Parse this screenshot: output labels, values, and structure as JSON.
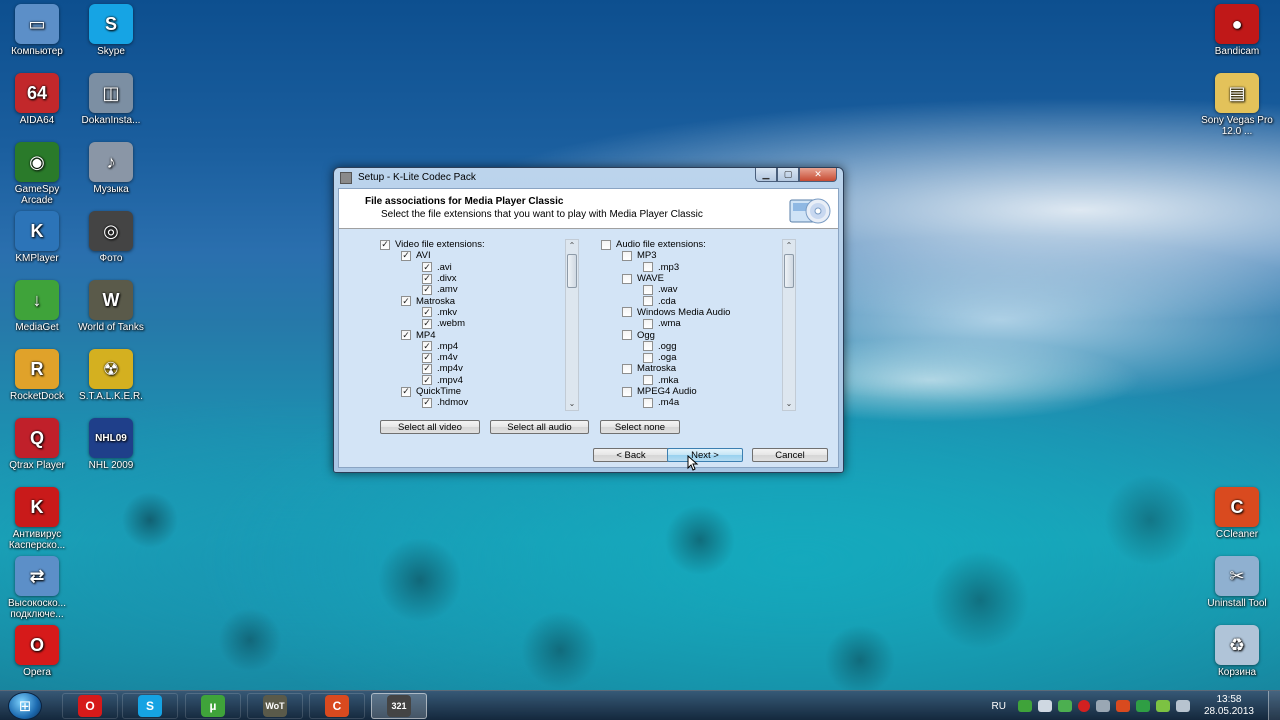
{
  "desktop": {
    "left_icons": [
      {
        "label": "Компьютер",
        "icon": "computer-icon"
      },
      {
        "label": "Skype",
        "icon": "skype-icon"
      },
      {
        "label": "AIDA64",
        "icon": "aida64-icon"
      },
      {
        "label": "DokanInsta...",
        "icon": "installer-icon"
      },
      {
        "label": "GameSpy Arcade",
        "icon": "gamespy-icon"
      },
      {
        "label": "Музыка",
        "icon": "music-folder-icon"
      },
      {
        "label": "KMPlayer",
        "icon": "kmplayer-icon"
      },
      {
        "label": "Фото",
        "icon": "camera-icon"
      },
      {
        "label": "MediaGet",
        "icon": "mediaget-icon"
      },
      {
        "label": "World of Tanks",
        "icon": "world-of-tanks-icon"
      },
      {
        "label": "RocketDock",
        "icon": "rocketdock-icon"
      },
      {
        "label": "S.T.A.L.K.E.R.",
        "icon": "stalker-icon"
      },
      {
        "label": "Qtrax Player",
        "icon": "qtrax-icon"
      },
      {
        "label": "NHL 2009",
        "icon": "nhl-icon"
      },
      {
        "label": "Антивирус Касперско...",
        "icon": "kaspersky-icon"
      },
      {
        "label": "Высокоско... подключе...",
        "icon": "network-connection-icon"
      },
      {
        "label": "Opera",
        "icon": "opera-icon"
      }
    ],
    "right_icons": [
      {
        "label": "Bandicam",
        "icon": "bandicam-icon"
      },
      {
        "label": "Sony Vegas Pro 12.0 ...",
        "icon": "folder-icon"
      },
      {
        "label": "CCleaner",
        "icon": "ccleaner-icon"
      },
      {
        "label": "Uninstall Tool",
        "icon": "uninstall-tool-icon"
      },
      {
        "label": "Корзина",
        "icon": "recycle-bin-icon"
      }
    ],
    "icon_badges": {
      "aida": "64",
      "bandicam": "●",
      "nhl": "NHL09"
    }
  },
  "window": {
    "title": "Setup - K-Lite Codec Pack",
    "minimize_glyph": "▁",
    "maximize_glyph": "▢",
    "close_glyph": "✕",
    "header_title": "File associations for Media Player Classic",
    "header_subtitle": "Select the file extensions that you want to play with Media Player Classic",
    "video_list": [
      {
        "label": "Video file extensions:",
        "level": 0,
        "checked": true
      },
      {
        "label": "AVI",
        "level": 1,
        "checked": true
      },
      {
        "label": ".avi",
        "level": 2,
        "checked": true
      },
      {
        "label": ".divx",
        "level": 2,
        "checked": true
      },
      {
        "label": ".amv",
        "level": 2,
        "checked": true
      },
      {
        "label": "Matroska",
        "level": 1,
        "checked": true
      },
      {
        "label": ".mkv",
        "level": 2,
        "checked": true
      },
      {
        "label": ".webm",
        "level": 2,
        "checked": true
      },
      {
        "label": "MP4",
        "level": 1,
        "checked": true
      },
      {
        "label": ".mp4",
        "level": 2,
        "checked": true
      },
      {
        "label": ".m4v",
        "level": 2,
        "checked": true
      },
      {
        "label": ".mp4v",
        "level": 2,
        "checked": true
      },
      {
        "label": ".mpv4",
        "level": 2,
        "checked": true
      },
      {
        "label": "QuickTime",
        "level": 1,
        "checked": true
      },
      {
        "label": ".hdmov",
        "level": 2,
        "checked": true
      }
    ],
    "audio_list": [
      {
        "label": "Audio file extensions:",
        "level": 0,
        "checked": false
      },
      {
        "label": "MP3",
        "level": 1,
        "checked": false
      },
      {
        "label": ".mp3",
        "level": 2,
        "checked": false
      },
      {
        "label": "WAVE",
        "level": 1,
        "checked": false
      },
      {
        "label": ".wav",
        "level": 2,
        "checked": false
      },
      {
        "label": ".cda",
        "level": 2,
        "checked": false
      },
      {
        "label": "Windows Media Audio",
        "level": 1,
        "checked": false
      },
      {
        "label": ".wma",
        "level": 2,
        "checked": false
      },
      {
        "label": "Ogg",
        "level": 1,
        "checked": false
      },
      {
        "label": ".ogg",
        "level": 2,
        "checked": false
      },
      {
        "label": ".oga",
        "level": 2,
        "checked": false
      },
      {
        "label": "Matroska",
        "level": 1,
        "checked": false
      },
      {
        "label": ".mka",
        "level": 2,
        "checked": false
      },
      {
        "label": "MPEG4 Audio",
        "level": 1,
        "checked": false
      },
      {
        "label": ".m4a",
        "level": 2,
        "checked": false
      }
    ],
    "select_all_video": "Select all video",
    "select_all_audio": "Select all audio",
    "select_none": "Select none",
    "back": "< Back",
    "next": "Next >",
    "cancel": "Cancel",
    "scroll_up_glyph": "⌃",
    "scroll_down_glyph": "⌄"
  },
  "taskbar": {
    "start_glyph": "⊞",
    "buttons": [
      {
        "name": "opera",
        "glyph": "O",
        "color": "#d61a1a",
        "active": false
      },
      {
        "name": "skype",
        "glyph": "S",
        "color": "#15a3e3",
        "active": false
      },
      {
        "name": "utorrent",
        "glyph": "µ",
        "color": "#3fa33a",
        "active": false
      },
      {
        "name": "world-of-tanks",
        "glyph": "WoT",
        "color": "#5a5a4a",
        "active": false
      },
      {
        "name": "ccleaner",
        "glyph": "C",
        "color": "#d94a1f",
        "active": false
      },
      {
        "name": "k-lite-setup",
        "glyph": "321",
        "color": "#444444",
        "active": true
      }
    ],
    "language": "RU",
    "time": "13:58",
    "date": "28.05.2013"
  }
}
